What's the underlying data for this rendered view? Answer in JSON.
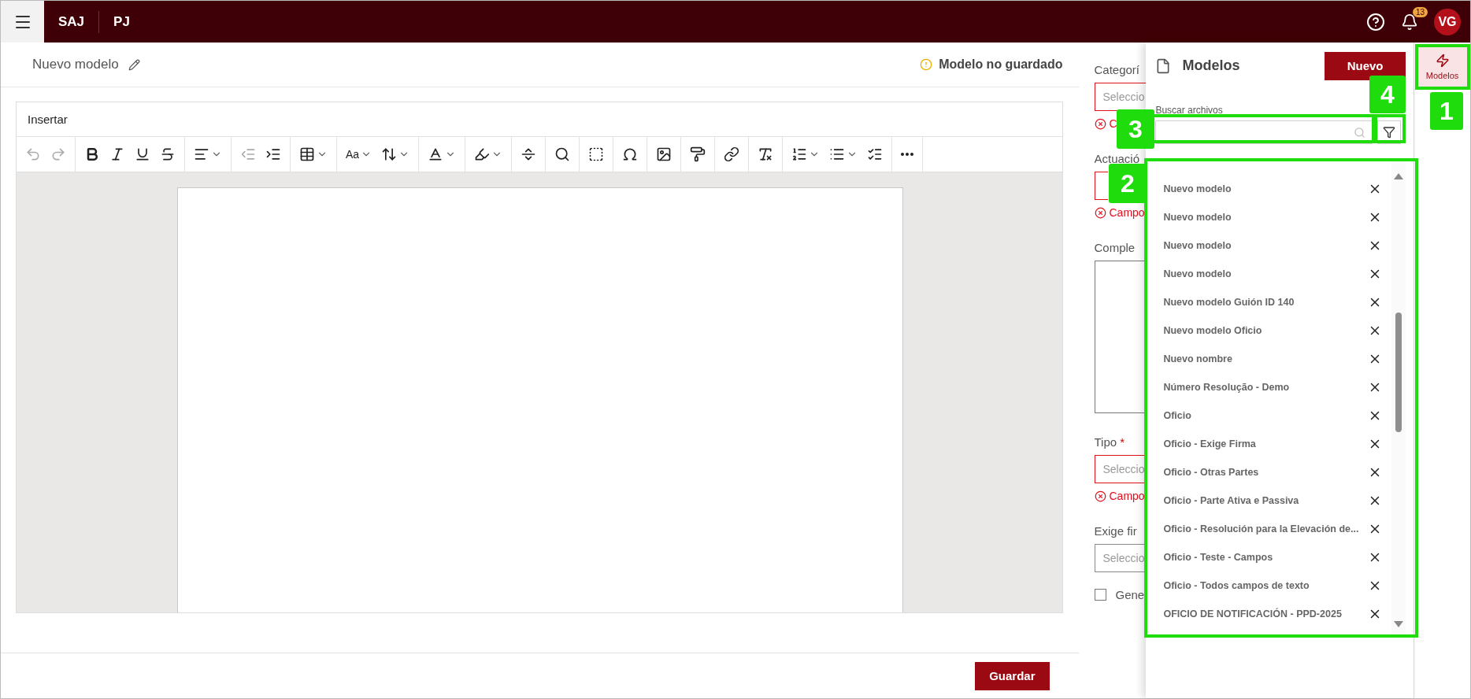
{
  "top_bar": {
    "brand": "SAJ",
    "module": "PJ",
    "notifications": "13",
    "avatar": "VG"
  },
  "header": {
    "title": "Nuevo modelo",
    "status": "Modelo no guardado"
  },
  "editor": {
    "menu": "Insertar",
    "toolbar": [
      [
        {
          "disabled": true,
          "dropdown": false
        },
        {
          "disabled": true,
          "dropdown": false
        }
      ],
      [
        {
          "disabled": false,
          "dropdown": false
        },
        {
          "disabled": false,
          "dropdown": false
        },
        {
          "disabled": false,
          "dropdown": false
        },
        {
          "disabled": false,
          "dropdown": false
        }
      ],
      [
        {
          "disabled": false,
          "dropdown": true
        }
      ],
      [
        {
          "disabled": true,
          "dropdown": false
        },
        {
          "disabled": false,
          "dropdown": false
        }
      ],
      [
        {
          "disabled": false,
          "dropdown": true
        }
      ],
      [
        {
          "disabled": false,
          "dropdown": true,
          "label": "Aa"
        },
        {
          "disabled": false,
          "dropdown": true
        }
      ],
      [
        {
          "disabled": false,
          "dropdown": true
        }
      ],
      [
        {
          "disabled": false,
          "dropdown": true
        }
      ],
      [
        {
          "disabled": false,
          "dropdown": false
        }
      ],
      [
        {
          "disabled": false,
          "dropdown": false
        }
      ],
      [
        {
          "disabled": false,
          "dropdown": false
        }
      ],
      [
        {
          "disabled": false,
          "dropdown": false
        }
      ],
      [
        {
          "disabled": false,
          "dropdown": false
        }
      ],
      [
        {
          "disabled": false,
          "dropdown": false
        }
      ],
      [
        {
          "disabled": false,
          "dropdown": false
        }
      ],
      [
        {
          "disabled": false,
          "dropdown": false
        }
      ],
      [
        {
          "disabled": false,
          "dropdown": true
        },
        {
          "disabled": false,
          "dropdown": true
        },
        {
          "disabled": false,
          "dropdown": false
        }
      ],
      [
        {
          "disabled": false,
          "dropdown": false
        }
      ]
    ]
  },
  "footer": {
    "save": "Guardar"
  },
  "form": {
    "fields": [
      {
        "kind": "select",
        "label": "Categorí",
        "placeholder": "Seleccio",
        "error": "C"
      },
      {
        "kind": "select",
        "label": "Actuació",
        "error": "Campo"
      },
      {
        "kind": "textarea",
        "label": "Comple"
      },
      {
        "kind": "select",
        "label": "Tipo",
        "required_mark": "*",
        "placeholder": "Seleccio",
        "error": "Campo"
      },
      {
        "kind": "select",
        "label": "Exige fir",
        "placeholder": "Seleccio"
      },
      {
        "kind": "checkbox",
        "label": "Gene",
        "checked": false
      }
    ]
  },
  "panel": {
    "title": "Modelos",
    "new_button": "Nuevo",
    "search_label": "Buscar archivos",
    "items": [
      "Nuevo modelo",
      "Nuevo modelo",
      "Nuevo modelo",
      "Nuevo modelo",
      "Nuevo modelo Guión ID 140",
      "Nuevo modelo Oficio",
      "Nuevo nombre",
      "Número Resolução - Demo",
      "Oficio",
      "Oficio - Exige Firma",
      "Oficio - Otras Partes",
      "Oficio - Parte Ativa e Passiva",
      "Oficio - Resolución para la Elevación de...",
      "Oficio - Teste - Campos",
      "Oficio - Todos campos de texto",
      "OFICIO DE NOTIFICACIÓN - PPD-2025"
    ]
  },
  "side_strip": [
    {
      "label": "Modelos",
      "selected": true
    }
  ],
  "callouts": [
    {
      "number": "1"
    },
    {
      "number": "2"
    },
    {
      "number": "3"
    },
    {
      "number": "4"
    }
  ]
}
